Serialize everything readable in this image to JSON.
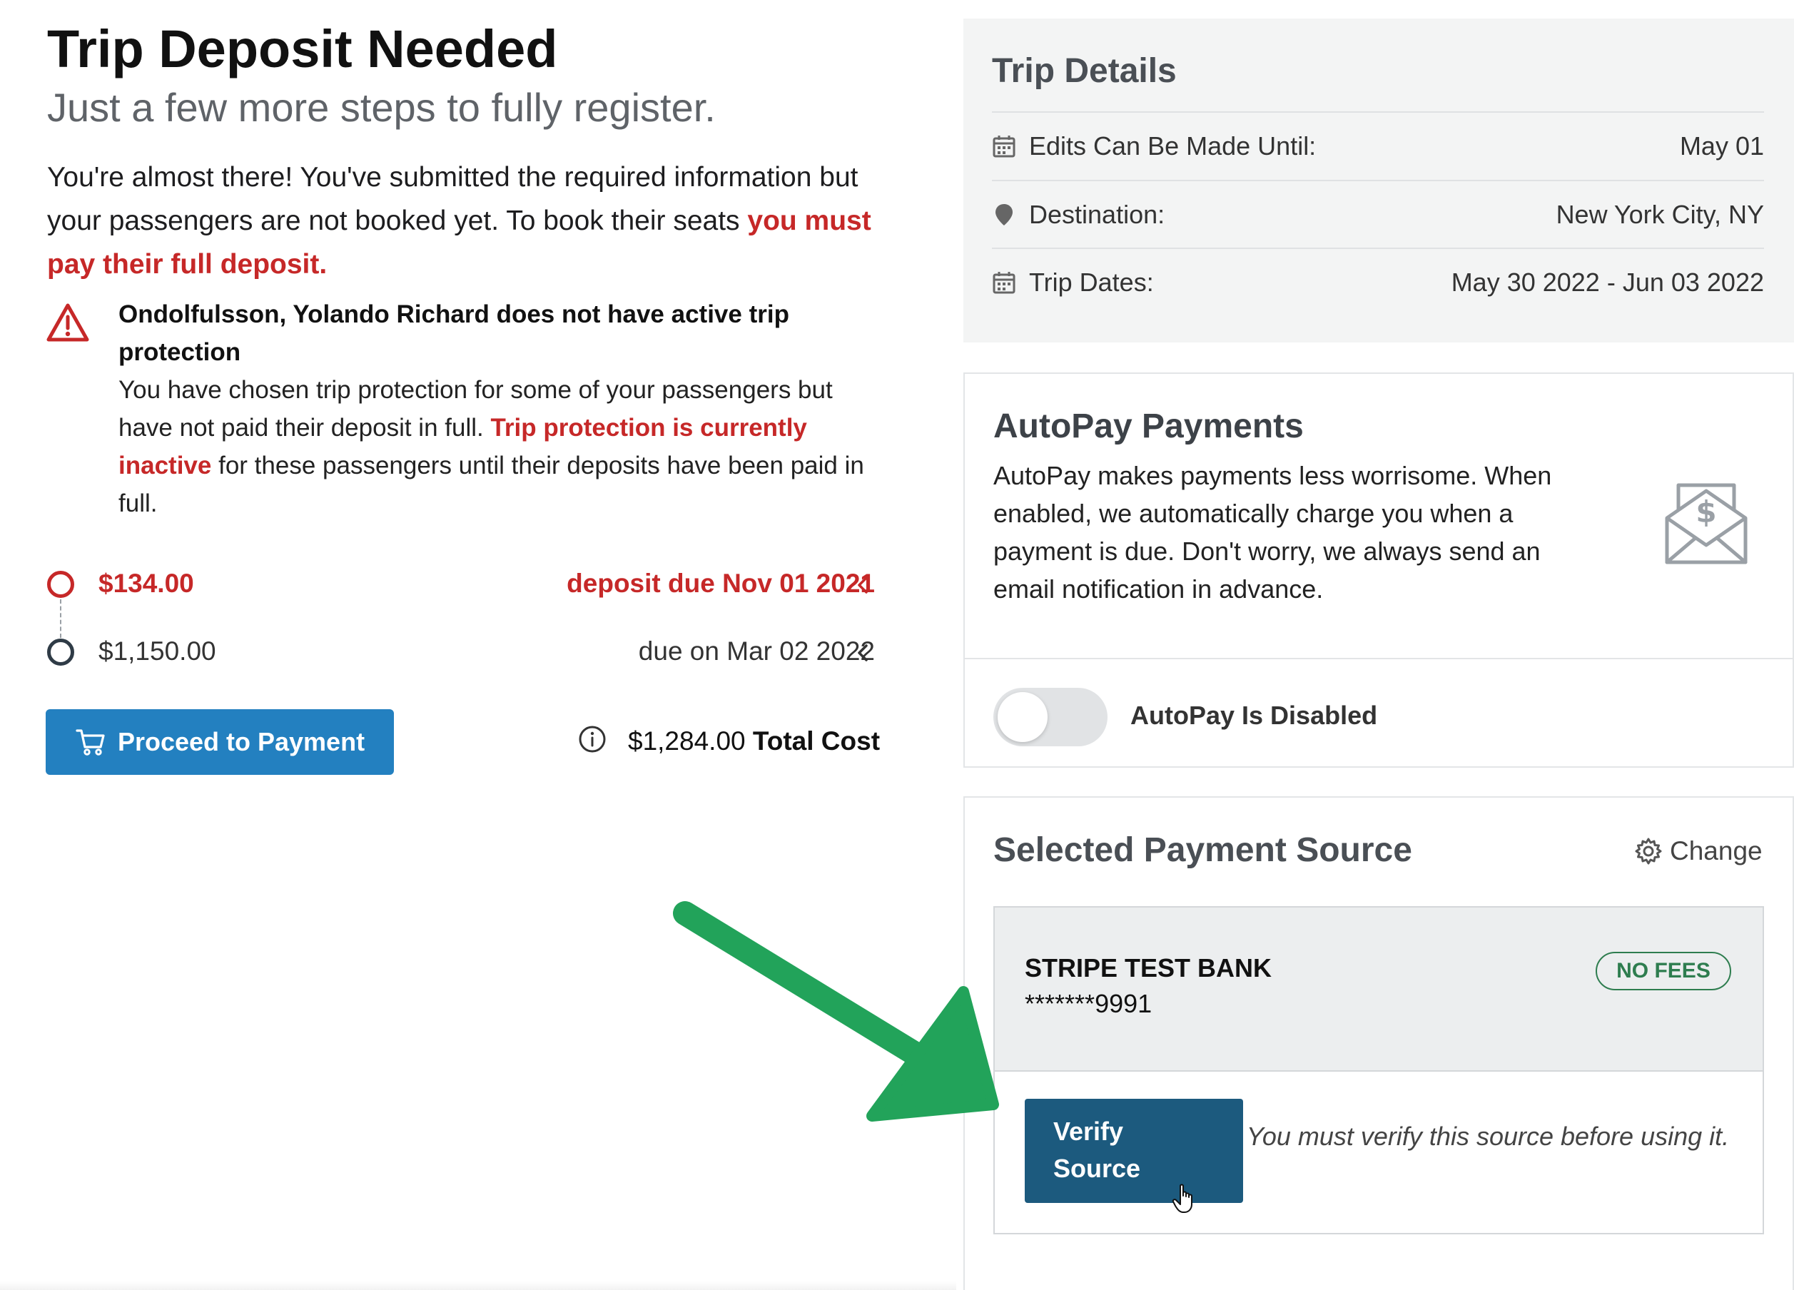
{
  "header": {
    "title": "Trip Deposit Needed",
    "subtitle": "Just a few more steps to fully register."
  },
  "intro": {
    "text": "You're almost there! You've submitted the required information but your passengers are not booked yet. To book their seats",
    "emphasis": "you must pay their full deposit."
  },
  "warning": {
    "icon": "warning-triangle-icon",
    "title": "Ondolfulsson, Yolando Richard does not have active trip protection",
    "body_start": "You have chosen trip protection for some of your passengers but have not paid their deposit in full.",
    "body_emphasis": "Trip protection is currently inactive",
    "body_end": "for these passengers until their deposits have been paid in full."
  },
  "schedule": [
    {
      "amount": "$134.00",
      "due": "deposit due Nov 01 2021"
    },
    {
      "amount": "$1,150.00",
      "due": "due on Mar 02 2022"
    }
  ],
  "payment": {
    "button_label": "Proceed to Payment",
    "total_amount": "$1,284.00",
    "total_label": "Total Cost"
  },
  "trip_details": {
    "title": "Trip Details",
    "rows": [
      {
        "icon": "calendar-icon",
        "label": "Edits Can Be Made Until:",
        "value": "May 01"
      },
      {
        "icon": "map-pin-icon",
        "label": "Destination:",
        "value": "New York City, NY"
      },
      {
        "icon": "calendar-icon",
        "label": "Trip Dates:",
        "value": "May 30 2022 - Jun 03 2022"
      }
    ]
  },
  "autopay": {
    "title": "AutoPay Payments",
    "description": "AutoPay makes payments less worrisome. When enabled, we automatically charge you when a payment is due. Don't worry, we always send an email notification in advance.",
    "status": "AutoPay Is Disabled",
    "enabled": false
  },
  "payment_source": {
    "title": "Selected Payment Source",
    "change_label": "Change",
    "bank_name": "STRIPE TEST BANK",
    "account": "*******9991",
    "badge": "NO FEES",
    "verify_label": "Verify Source",
    "verify_note": "You must verify this source before using it."
  },
  "colors": {
    "accent_red": "#c62828",
    "primary_blue": "#2380c0",
    "verify_blue": "#1c5a7e",
    "badge_green": "#2e7d4f",
    "arrow_green": "#22a35a"
  }
}
